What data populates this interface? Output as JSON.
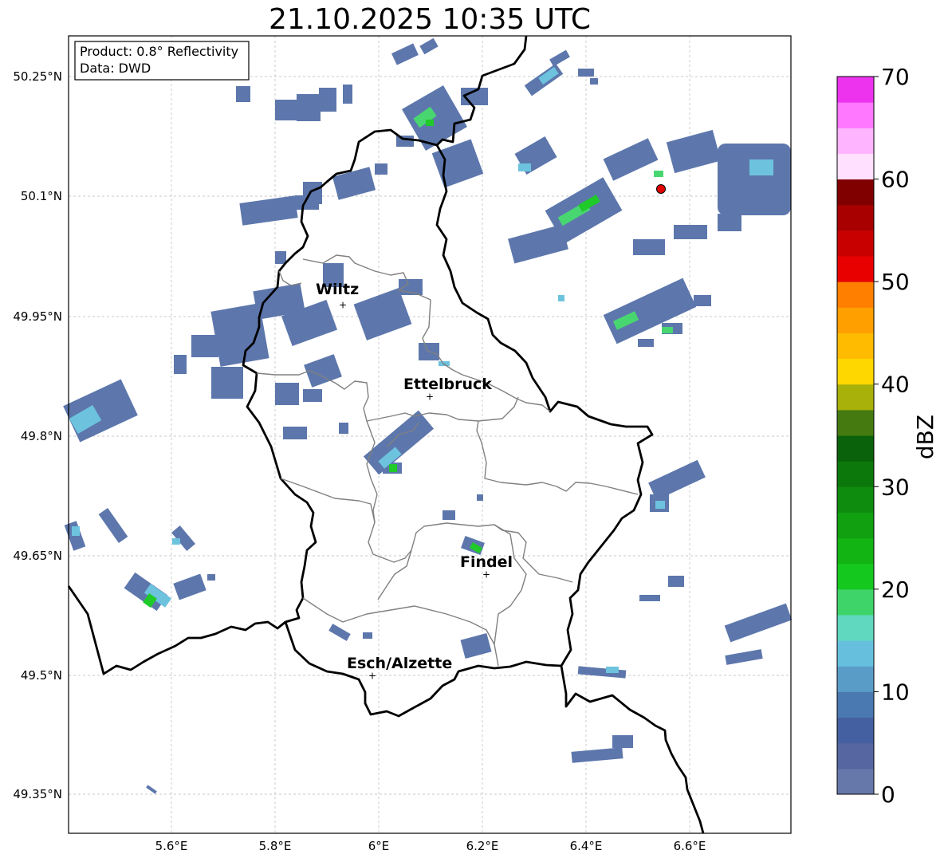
{
  "title": "21.10.2025 10:35 UTC",
  "info": {
    "product": "Product: 0.8° Reflectivity",
    "data": "Data: DWD"
  },
  "x_ticks": [
    "5.6°E",
    "5.8°E",
    "6°E",
    "6.2°E",
    "6.4°E",
    "6.6°E"
  ],
  "y_ticks": [
    "50.25°N",
    "50.1°N",
    "49.95°N",
    "49.8°N",
    "49.65°N",
    "49.5°N",
    "49.35°N"
  ],
  "colorbar": {
    "label": "dBZ",
    "ticks": [
      "0",
      "10",
      "20",
      "30",
      "40",
      "50",
      "60",
      "70"
    ],
    "colors": [
      "#6677aa",
      "#5566a0",
      "#4560a0",
      "#4a78b0",
      "#5a9cc8",
      "#66c0dd",
      "#60d8c0",
      "#3fd46a",
      "#14c81e",
      "#12b414",
      "#10a010",
      "#0e8c0e",
      "#0c780c",
      "#0a620a",
      "#457a10",
      "#a8b00a",
      "#ffd700",
      "#ffbb00",
      "#ff9f00",
      "#ff7f00",
      "#e80000",
      "#c80000",
      "#a80000",
      "#800000",
      "#ffe0ff",
      "#ffb4ff",
      "#ff78ff",
      "#ee33ee"
    ]
  },
  "cities": [
    {
      "name": "Wiltz",
      "lon": 5.93,
      "lat": 49.965
    },
    {
      "name": "Ettelbruck",
      "lon": 6.1,
      "lat": 49.85
    },
    {
      "name": "Findel",
      "lon": 6.21,
      "lat": 49.625
    },
    {
      "name": "Esch/Alzette",
      "lon": 5.99,
      "lat": 49.5
    }
  ],
  "radar_site": {
    "lon": 6.55,
    "lat": 50.11,
    "color": "#e00000"
  }
}
